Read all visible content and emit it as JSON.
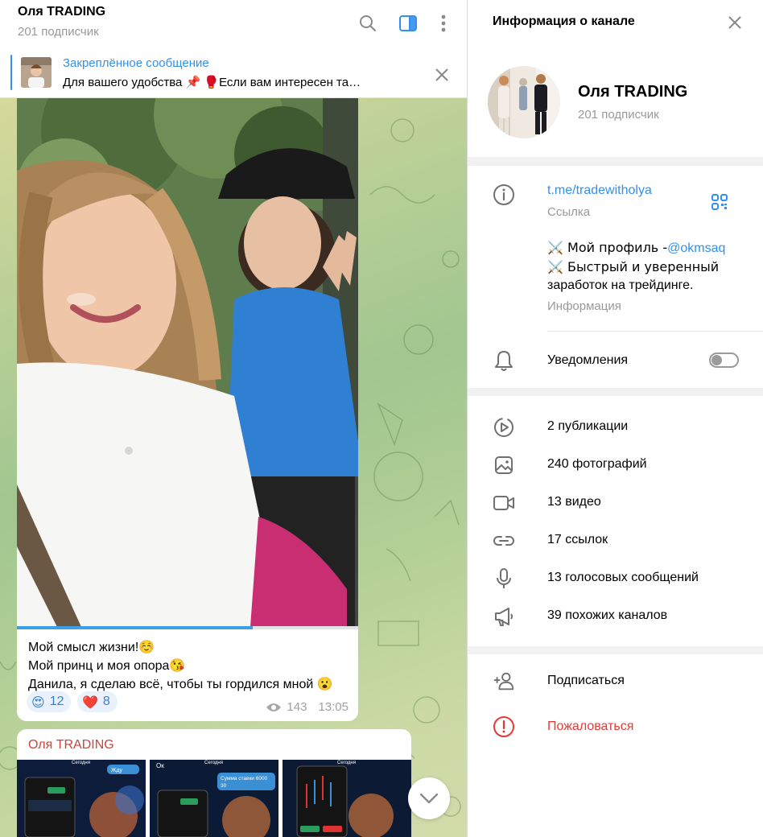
{
  "chat": {
    "title": "Оля TRADING",
    "subscribers": "201 подписчик",
    "icons": [
      "search-icon",
      "sidebar-toggle-icon",
      "more-icon"
    ]
  },
  "pinned": {
    "title": "Закреплённое сообщение",
    "text": "Для вашего удобства 📌 🥊Если вам интересен та…"
  },
  "message1": {
    "caption": [
      "Мой смысл жизни!☺️",
      "Мой принц и моя опора😘",
      "Данила, я сделаю всё, чтобы ты гордился мной 😮"
    ],
    "reactions": [
      {
        "emoji": "😍",
        "count": "12"
      },
      {
        "emoji": "❤️",
        "count": "8"
      }
    ],
    "views": "143",
    "time": "13:05",
    "progress": 0.69
  },
  "message2": {
    "author": "Оля TRADING",
    "thumb_texts": {
      "t1_header": "Сегодня",
      "t1_bubble": "Жду",
      "t2_header": "Сегодня",
      "t2_left": "Ок",
      "t2_bubble_1": "Сумма ставки 6000",
      "t2_bubble_2": "30",
      "t3_header": "Сегодня"
    }
  },
  "info": {
    "title": "Информация о канале",
    "name": "Оля TRADING",
    "subscribers": "201 подписчик",
    "link": "t.me/tradewitholya",
    "link_label": "Ссылка",
    "about_line1_prefix": "⚔️ Мой профиль -",
    "about_line1_handle": "@okmsaq",
    "about_line2": "⚔️ Быстрый и уверенный",
    "about_line3": "заработок на трейдинге.",
    "about_label": "Информация",
    "notifications": "Уведомления",
    "notifications_on": false,
    "media": [
      {
        "icon": "publications-icon",
        "label": "2 публикации"
      },
      {
        "icon": "photo-icon",
        "label": "240 фотографий"
      },
      {
        "icon": "video-icon",
        "label": "13 видео"
      },
      {
        "icon": "link-icon",
        "label": "17 ссылок"
      },
      {
        "icon": "microphone-icon",
        "label": "13 голосовых сообщений"
      },
      {
        "icon": "megaphone-icon",
        "label": "39 похожих каналов"
      }
    ],
    "subscribe": "Подписаться",
    "report": "Пожаловаться"
  },
  "colors": {
    "accent": "#3390ec",
    "danger": "#e53935",
    "author": "#c8443c",
    "muted": "#999999"
  }
}
